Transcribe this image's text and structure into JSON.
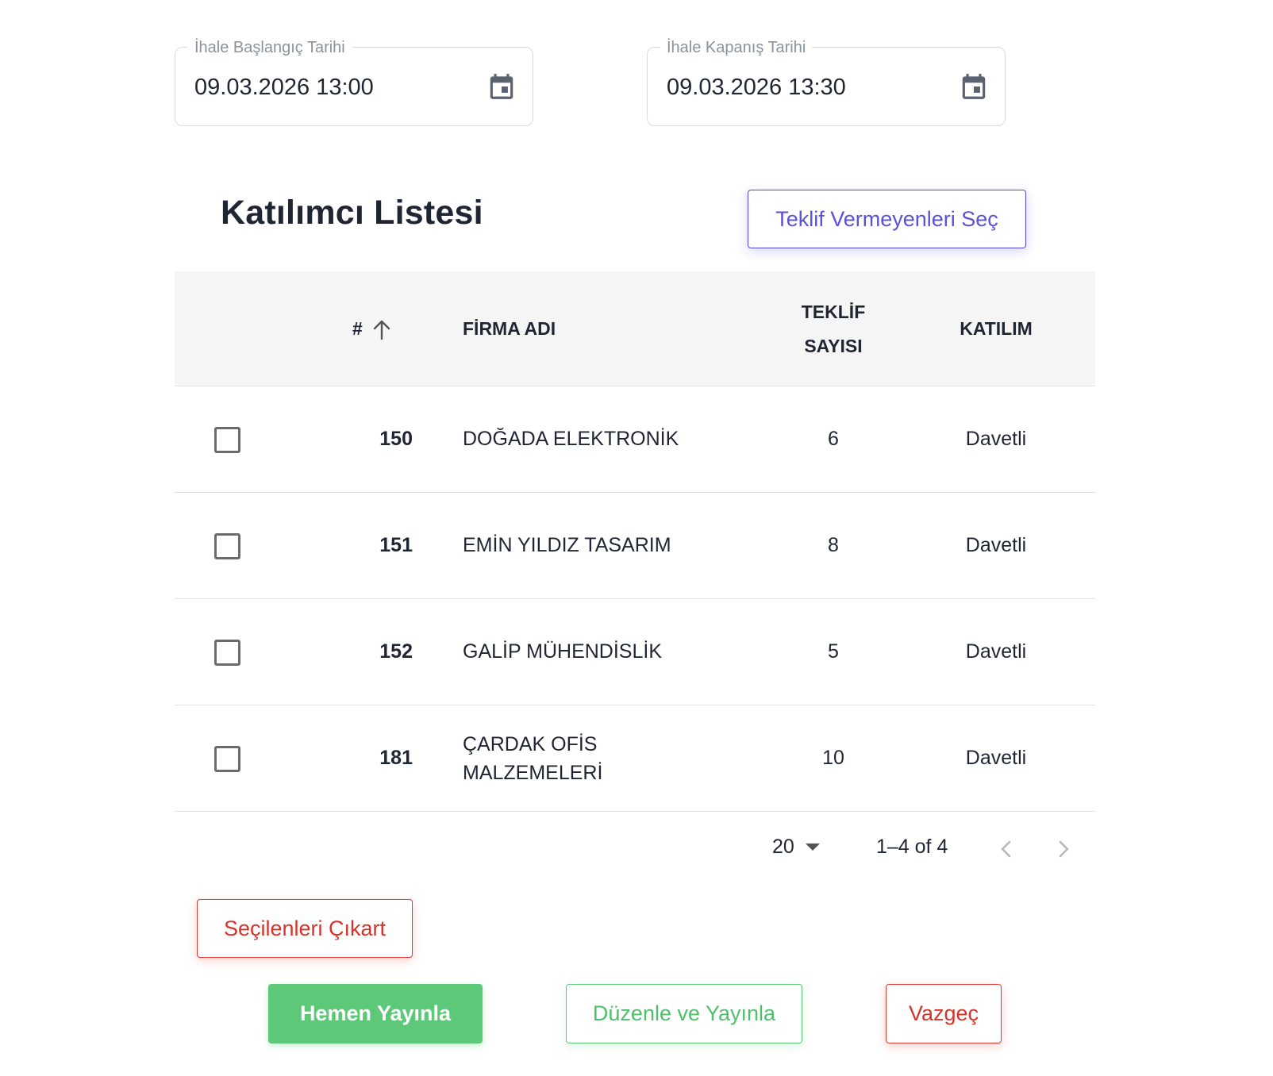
{
  "dates": {
    "start": {
      "label": "İhale Başlangıç Tarihi",
      "value": "09.03.2026 13:00"
    },
    "end": {
      "label": "İhale Kapanış Tarihi",
      "value": "09.03.2026 13:30"
    }
  },
  "participants": {
    "title": "Katılımcı Listesi",
    "select_non_bidders_label": "Teklif Vermeyenleri Seç",
    "columns": {
      "num": "#",
      "firma": "FİRMA ADI",
      "teklif_line1": "TEKLİF",
      "teklif_line2": "SAYISI",
      "katilim": "KATILIM"
    },
    "rows": [
      {
        "num": "150",
        "firma": "DOĞADA ELEKTRONİK",
        "teklif": "6",
        "katilim": "Davetli"
      },
      {
        "num": "151",
        "firma": "EMİN YILDIZ TASARIM",
        "teklif": "8",
        "katilim": "Davetli"
      },
      {
        "num": "152",
        "firma": "GALİP MÜHENDİSLİK",
        "teklif": "5",
        "katilim": "Davetli"
      },
      {
        "num": "181",
        "firma_line1": "ÇARDAK OFİS",
        "firma_line2": "MALZEMELERİ",
        "teklif": "10",
        "katilim": "Davetli"
      }
    ],
    "pagination": {
      "rows_per_page": "20",
      "range": "1–4 of 4"
    }
  },
  "actions": {
    "remove_selected": "Seçilenleri Çıkart",
    "publish_now": "Hemen Yayınla",
    "edit_and_publish": "Düzenle ve Yayınla",
    "cancel": "Vazgeç"
  },
  "icons": {
    "calendar": "calendar-icon",
    "sort": "arrow-up-icon",
    "prev": "chevron-left-icon",
    "next": "chevron-right-icon",
    "dropdown": "caret-down-icon"
  },
  "colors": {
    "purple": "#5a52d8",
    "red": "#d8322a",
    "green": "#5ec879",
    "header_bg": "#f5f5f5"
  }
}
